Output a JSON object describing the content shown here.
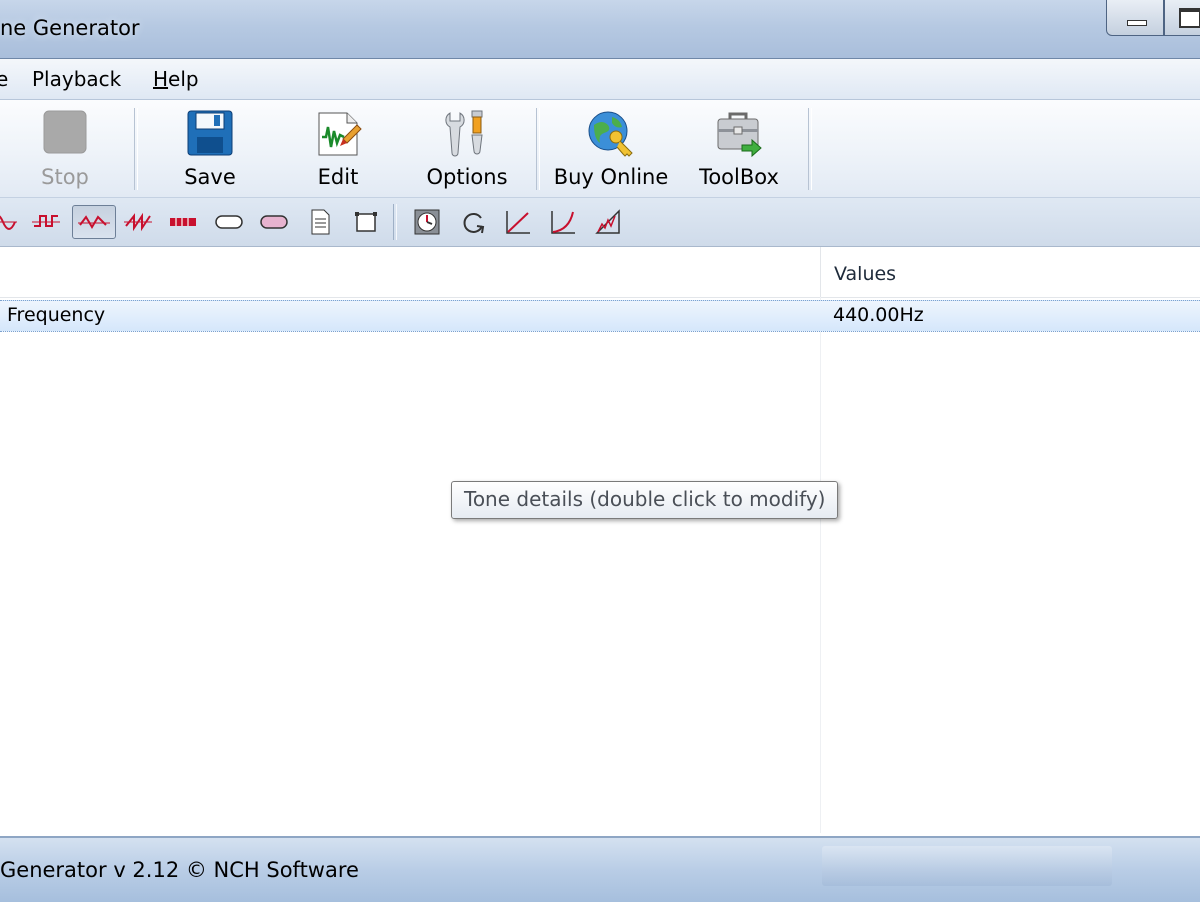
{
  "window": {
    "title": "ne Generator",
    "buttons": [
      "minimize",
      "maximize"
    ]
  },
  "menubar": {
    "items": [
      {
        "label": "e"
      },
      {
        "label": "Playback"
      },
      {
        "label_underlined": "H",
        "label_rest": "elp"
      }
    ]
  },
  "toolbar": {
    "stop_label": "Stop",
    "save_label": "Save",
    "edit_label": "Edit",
    "options_label": "Options",
    "buy_online_label": "Buy Online",
    "toolbox_label": "ToolBox"
  },
  "toolbar2": {
    "icons": [
      "sine-wave-icon",
      "square-wave-icon",
      "triangle-wave-icon",
      "sawtooth-wave-icon",
      "pulse-wave-icon",
      "white-noise-icon",
      "pink-noise-icon",
      "document-icon",
      "crop-icon",
      "clock-icon",
      "loop-icon",
      "linear-sweep-icon",
      "log-sweep-icon",
      "level-icon"
    ],
    "pressed": "triangle-wave-icon",
    "wave_color": "#c8102e"
  },
  "listview": {
    "columns": [
      "",
      "Values"
    ],
    "rows": [
      {
        "property": "Frequency",
        "value": "440.00Hz"
      }
    ],
    "tooltip": "Tone details (double click to modify)"
  },
  "statusbar": {
    "text": "Generator v 2.12 © NCH Software"
  }
}
